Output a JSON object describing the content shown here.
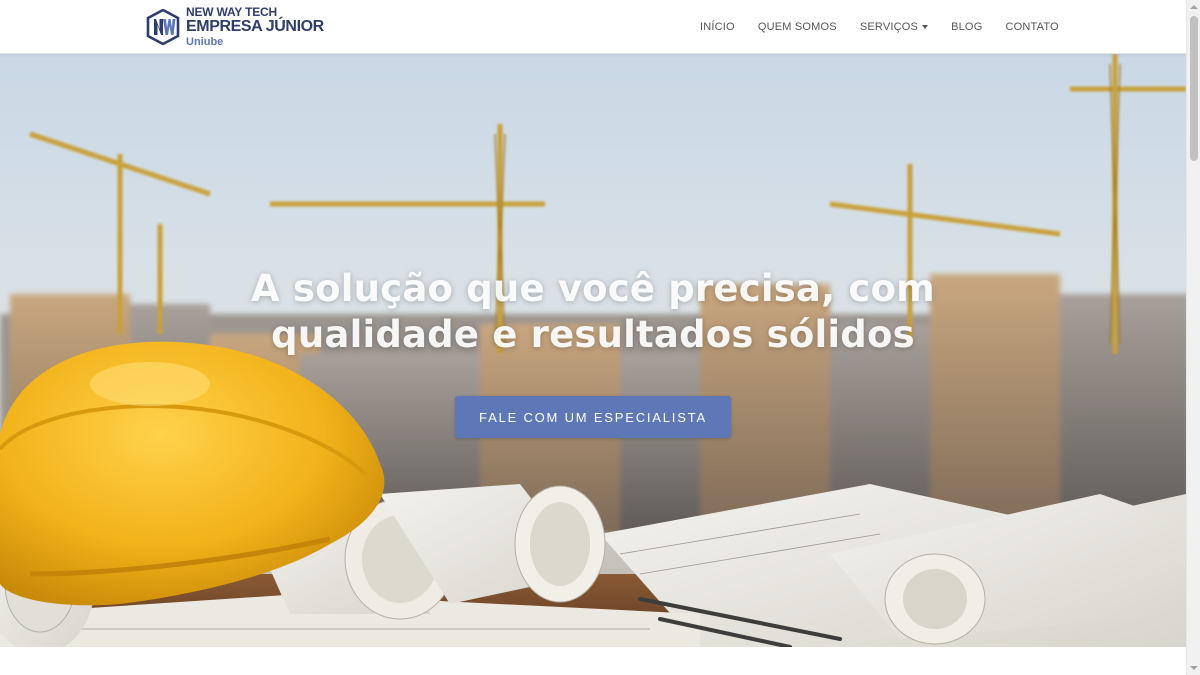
{
  "brand": {
    "line1": "NEW WAY TECH",
    "line2": "EMPRESA JÚNIOR",
    "line3": "Uniube",
    "primary_color": "#2f3d6b",
    "accent_color": "#5b77b8"
  },
  "nav": {
    "items": [
      {
        "label": "INÍCIO"
      },
      {
        "label": "QUEM SOMOS"
      },
      {
        "label": "SERVIÇOS",
        "has_dropdown": true
      },
      {
        "label": "BLOG"
      },
      {
        "label": "CONTATO"
      }
    ]
  },
  "hero": {
    "title_line1": "A solução que você precisa, com",
    "title_line2": "qualidade e resultados sólidos",
    "cta_label": "FALE COM UM ESPECIALISTA",
    "cta_color": "#5e77b7",
    "background_image": "construction-site-with-cranes-hard-hat-and-blueprints"
  }
}
